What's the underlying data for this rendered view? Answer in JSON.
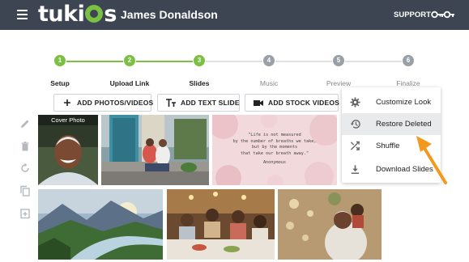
{
  "header": {
    "logo_text": "tuki",
    "logo_text_end": "s",
    "user_name": "James Donaldson",
    "support_label": "SUPPORT",
    "icons": {
      "menu": "hamburger-icon",
      "account": "key-icon"
    }
  },
  "stepper": {
    "steps": [
      {
        "number": "1",
        "label": "Setup",
        "state": "done"
      },
      {
        "number": "2",
        "label": "Upload Link",
        "state": "done"
      },
      {
        "number": "3",
        "label": "Slides",
        "state": "done"
      },
      {
        "number": "4",
        "label": "Music",
        "state": "todo"
      },
      {
        "number": "5",
        "label": "Preview",
        "state": "todo"
      },
      {
        "number": "6",
        "label": "Finalize",
        "state": "todo"
      }
    ]
  },
  "toolbar": {
    "add_photos_label": "ADD PHOTOS/VIDEOS",
    "add_text_label": "ADD TEXT SLIDE",
    "add_stock_label": "ADD STOCK VIDEOS"
  },
  "side_tools": [
    "edit-icon",
    "trash-icon",
    "rotate-icon",
    "copy-icon",
    "add-slide-icon"
  ],
  "slides": {
    "cover_label": "Cover Photo",
    "quote_lines": [
      "\"Life is not measured",
      "by the number of breaths we take,",
      "but by the moments",
      "that take our breath away.\""
    ],
    "quote_author": "Anonymous"
  },
  "menu": {
    "items": [
      {
        "label": "Customize Look",
        "icon": "gear-icon",
        "highlighted": false
      },
      {
        "label": "Restore Deleted",
        "icon": "history-icon",
        "highlighted": true
      },
      {
        "label": "Shuffle",
        "icon": "shuffle-icon",
        "highlighted": false
      },
      {
        "label": "Download Slides",
        "icon": "download-icon",
        "highlighted": false
      }
    ]
  },
  "colors": {
    "header_bg": "#3d4452",
    "accent_green": "#7ac143",
    "arrow_orange": "#f39a1e"
  }
}
